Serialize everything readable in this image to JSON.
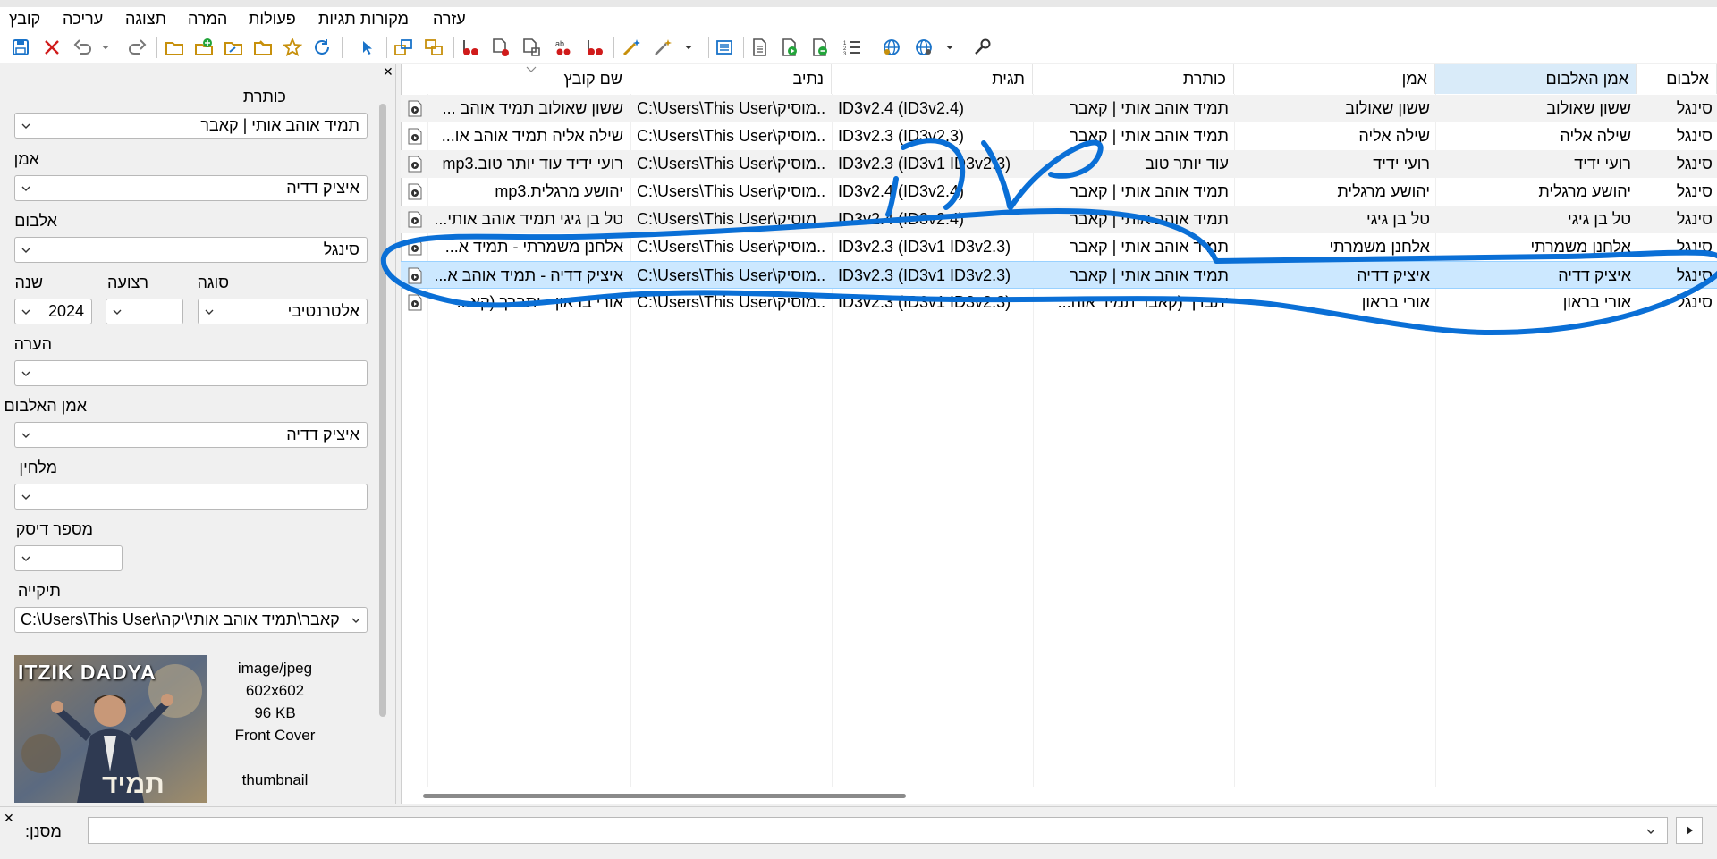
{
  "menu": [
    "קובץ",
    "עריכה",
    "תצוגה",
    "המרה",
    "פעולות",
    "מקורות תגיות",
    "עזרה"
  ],
  "toolbar_icons": [
    "save-icon",
    "close-icon",
    "undo-icon",
    "undo-dropdown-icon",
    "redo-icon",
    "open-folder-icon",
    "add-folder-icon",
    "browse-folder-icon",
    "open-folder-alt-icon",
    "folder-up-icon",
    "favorite-star-icon",
    "refresh-icon",
    "select-icon",
    "tag-to-filename-icon",
    "filename-to-tag-icon",
    "remove-tag-icon",
    "tag-from-file-icon",
    "tag-to-file-icon",
    "case-conversion-icon",
    "remove-fields-icon",
    "auto-numbering-wizard-icon",
    "action-wizard-icon",
    "actions-dropdown-icon",
    "export-icon",
    "playlist-icon",
    "play-icon",
    "play-list-icon",
    "numbered-list-icon",
    "web-source-icon",
    "web-source-alt-icon",
    "web-dropdown-icon",
    "options-wrench-icon"
  ],
  "panel": {
    "title_label": "כותרת",
    "title_value": "תמיד אוהב אותי | קאבר",
    "artist_label": "אמן",
    "artist_value": "איציק דדיה",
    "album_label": "אלבום",
    "album_value": "סינגל",
    "year_label": "שנה",
    "year_value": "2024",
    "track_label": "רצועה",
    "track_value": "",
    "genre_label": "סוגה",
    "genre_value": "אלטרנטיבי",
    "comment_label": "הערה",
    "comment_value": "",
    "album_artist_label": "אמן האלבום",
    "album_artist_value": "איציק דדיה",
    "composer_label": "מלחין",
    "composer_value": "",
    "discnumber_label": "מספר דיסק",
    "discnumber_value": "",
    "directory_label": "תיקייה",
    "directory_value": "C:\\Users\\This User\\קאבר\\תמיד אוהב אותי\\יקה",
    "cover_text": "ITZIK DADYA",
    "cover_bottom_text": "תמיד",
    "image_info": {
      "mime": "image/jpeg",
      "dimensions": "602x602",
      "size": "96 KB",
      "type": "Front Cover",
      "description": "thumbnail"
    }
  },
  "columns": [
    "שם קובץ",
    "נתיב",
    "תגית",
    "כותרת",
    "אמן",
    "אמן האלבום",
    "אלבום"
  ],
  "rows": [
    {
      "filename": "ששון שאולוב תמיד אוהב ...",
      "path": "C:\\Users\\This User\\מוסיק...",
      "tag": "ID3v2.4 (ID3v2.4)",
      "title": "תמיד אוהב אותי | קאבר",
      "artist": "ששון שאולוב",
      "album_artist": "ששון שאולוב",
      "album": "סינגל"
    },
    {
      "filename": "שילה אליה תמיד אוהב או...",
      "path": "C:\\Users\\This User\\מוסיק...",
      "tag": "ID3v2.3 (ID3v2.3)",
      "title": "תמיד אוהב אותי | קאבר",
      "artist": "שילה אליה",
      "album_artist": "שילה אליה",
      "album": "סינגל"
    },
    {
      "filename": "רועי ידיד עוד יותר טוב.mp3",
      "path": "C:\\Users\\This User\\מוסיק...",
      "tag": "ID3v2.3 (ID3v1 ID3v2.3)",
      "title": "עוד יותר טוב",
      "artist": "רועי ידיד",
      "album_artist": "רועי ידיד",
      "album": "סינגל"
    },
    {
      "filename": "יהושע מרגלית.mp3",
      "path": "C:\\Users\\This User\\מוסיק...",
      "tag": "ID3v2.4 (ID3v2.4)",
      "title": "תמיד אוהב אותי | קאבר",
      "artist": "יהושע מרגלית",
      "album_artist": "יהושע מרגלית",
      "album": "סינגל"
    },
    {
      "filename": "טל בן גיגי תמיד אוהב אותי...",
      "path": "C:\\Users\\This User\\מוסיק...",
      "tag": "ID3v2.4 (ID3v2.4)",
      "title": "תמיד אוהב אותי | קאבר",
      "artist": "טל בן גיגי",
      "album_artist": "טל בן גיגי",
      "album": "סינגל"
    },
    {
      "filename": "אלחנן משמרתי - תמיד א...",
      "path": "C:\\Users\\This User\\מוסיק...",
      "tag": "ID3v2.3 (ID3v1 ID3v2.3)",
      "title": "תמיד אוהב אותי | קאבר",
      "artist": "אלחנן משמרתי",
      "album_artist": "אלחנן משמרתי",
      "album": "סינגל"
    },
    {
      "filename": "איציק דדיה - תמיד אוהב א...",
      "path": "C:\\Users\\This User\\מוסיק...",
      "tag": "ID3v2.3 (ID3v1 ID3v2.3)",
      "title": "תמיד אוהב אותי | קאבר",
      "artist": "איציק דדיה",
      "album_artist": "איציק דדיה",
      "album": "סינגל"
    },
    {
      "filename": "אורי בראון - יתברך (קא...",
      "path": "C:\\Users\\This User\\מוסיק...",
      "tag": "ID3v2.3 (ID3v1 ID3v2.3)",
      "title": "יתברך (קאבר תמיד אוה...",
      "artist": "אורי בראון",
      "album_artist": "אורי בראון",
      "album": "סינגל"
    }
  ],
  "selected_row_index": 6,
  "filter": {
    "label": "מסנן:",
    "value": ""
  },
  "colors": {
    "selection": "#cce8ff",
    "header_active": "#d9ebf9",
    "annotation": "#0a6fd6",
    "accent_icon": "#1a73c9",
    "red_icon": "#d01b1b"
  }
}
